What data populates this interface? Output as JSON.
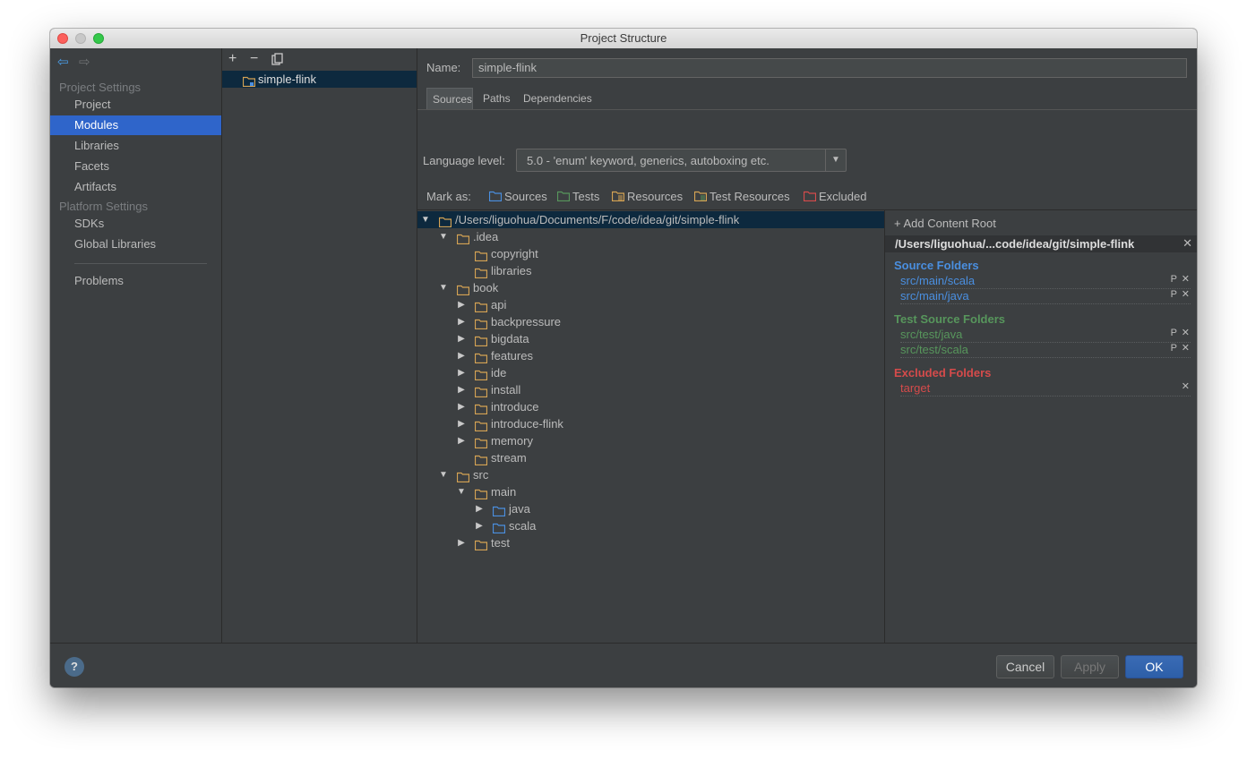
{
  "window": {
    "title": "Project Structure"
  },
  "nav": {
    "project_settings_heading": "Project Settings",
    "items_project": [
      "Project",
      "Modules",
      "Libraries",
      "Facets",
      "Artifacts"
    ],
    "platform_settings_heading": "Platform Settings",
    "items_platform": [
      "SDKs",
      "Global Libraries"
    ],
    "problems": "Problems",
    "selected": "Modules"
  },
  "modules_panel": {
    "toolbar": {
      "add": "+",
      "remove": "−"
    },
    "modules": [
      "simple-flink"
    ]
  },
  "module": {
    "name_label": "Name:",
    "name_value": "simple-flink",
    "tabs": [
      "Sources",
      "Paths",
      "Dependencies"
    ],
    "active_tab": "Sources",
    "language_level_label": "Language level:",
    "language_level_value": "5.0 - 'enum' keyword, generics, autoboxing etc.",
    "mark_as_label": "Mark as:",
    "mark_as": [
      "Sources",
      "Tests",
      "Resources",
      "Test Resources",
      "Excluded"
    ]
  },
  "tree": [
    {
      "label": "/Users/liguohua/Documents/F/code/idea/git/simple-flink",
      "depth": 0,
      "toggle": "expanded",
      "selected": true
    },
    {
      "label": ".idea",
      "depth": 1,
      "toggle": "expanded"
    },
    {
      "label": "copyright",
      "depth": 2,
      "toggle": "none"
    },
    {
      "label": "libraries",
      "depth": 2,
      "toggle": "none"
    },
    {
      "label": "book",
      "depth": 1,
      "toggle": "expanded"
    },
    {
      "label": "api",
      "depth": 2,
      "toggle": "collapsed"
    },
    {
      "label": "backpressure",
      "depth": 2,
      "toggle": "collapsed"
    },
    {
      "label": "bigdata",
      "depth": 2,
      "toggle": "collapsed"
    },
    {
      "label": "features",
      "depth": 2,
      "toggle": "collapsed"
    },
    {
      "label": "ide",
      "depth": 2,
      "toggle": "collapsed"
    },
    {
      "label": "install",
      "depth": 2,
      "toggle": "collapsed"
    },
    {
      "label": "introduce",
      "depth": 2,
      "toggle": "collapsed"
    },
    {
      "label": "introduce-flink",
      "depth": 2,
      "toggle": "collapsed"
    },
    {
      "label": "memory",
      "depth": 2,
      "toggle": "collapsed"
    },
    {
      "label": "stream",
      "depth": 2,
      "toggle": "none"
    },
    {
      "label": "src",
      "depth": 1,
      "toggle": "expanded"
    },
    {
      "label": "main",
      "depth": 2,
      "toggle": "expanded"
    },
    {
      "label": "java",
      "depth": 3,
      "toggle": "collapsed",
      "kind": "source"
    },
    {
      "label": "scala",
      "depth": 3,
      "toggle": "collapsed",
      "kind": "source"
    },
    {
      "label": "test",
      "depth": 2,
      "toggle": "collapsed"
    }
  ],
  "content_roots": {
    "add_label": "+ Add Content Root",
    "root_path": "/Users/liguohua/...code/idea/git/simple-flink",
    "source_heading": "Source Folders",
    "source_folders": [
      "src/main/scala",
      "src/main/java"
    ],
    "test_heading": "Test Source Folders",
    "test_folders": [
      "src/test/java",
      "src/test/scala"
    ],
    "excluded_heading": "Excluded Folders",
    "excluded_folders": [
      "target"
    ]
  },
  "buttons": {
    "help": "?",
    "cancel": "Cancel",
    "apply": "Apply",
    "ok": "OK"
  },
  "colors": {
    "source": "#4a8fe0",
    "test": "#57965c",
    "excluded": "#d54b4b",
    "selection": "#2f65ca",
    "folder": "#d5a354"
  }
}
